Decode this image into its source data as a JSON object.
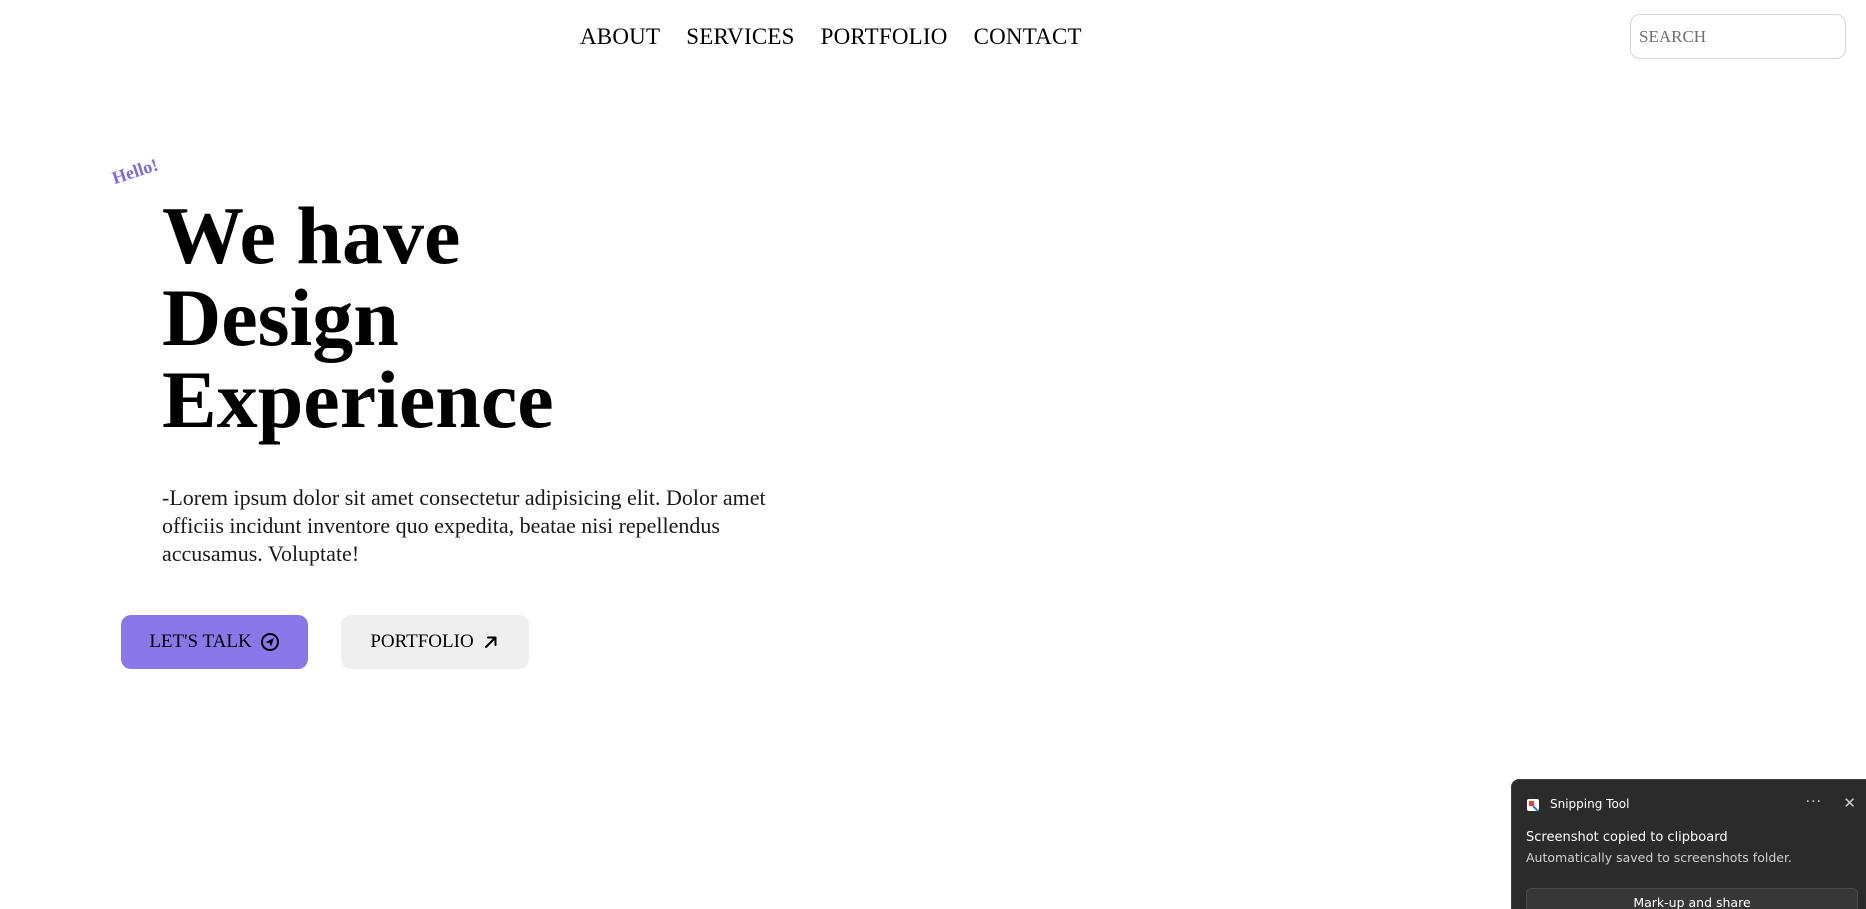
{
  "nav": {
    "items": [
      {
        "label": "ABOUT"
      },
      {
        "label": "SERVICES"
      },
      {
        "label": "PORTFOLIO"
      },
      {
        "label": "CONTACT"
      }
    ]
  },
  "search": {
    "placeholder": "SEARCH",
    "value": ""
  },
  "hero": {
    "greeting": "Hello!",
    "headline": [
      "We have",
      "Design",
      "Experience"
    ],
    "description": "-Lorem ipsum dolor sit amet consectetur adipisicing elit. Dolor amet officiis incidunt inventore quo expedita, beatae nisi repellendus accusamus. Voluptate!",
    "primary_button": {
      "label": "LET'S TALK",
      "icon": "send-circle-icon"
    },
    "secondary_button": {
      "label": "PORTFOLIO",
      "icon": "arrow-up-right-icon"
    }
  },
  "colors": {
    "accent": "#8a78ea",
    "greeting": "#7b6ce6",
    "secondary_button_bg": "#efefef",
    "toast_bg": "#2b2b2b"
  },
  "toast": {
    "app_name": "Snipping Tool",
    "app_icon": "snipping-tool-icon",
    "more_label": "···",
    "close_label": "✕",
    "title": "Screenshot copied to clipboard",
    "message": "Automatically saved to screenshots folder.",
    "action_label": "Mark-up and share"
  }
}
